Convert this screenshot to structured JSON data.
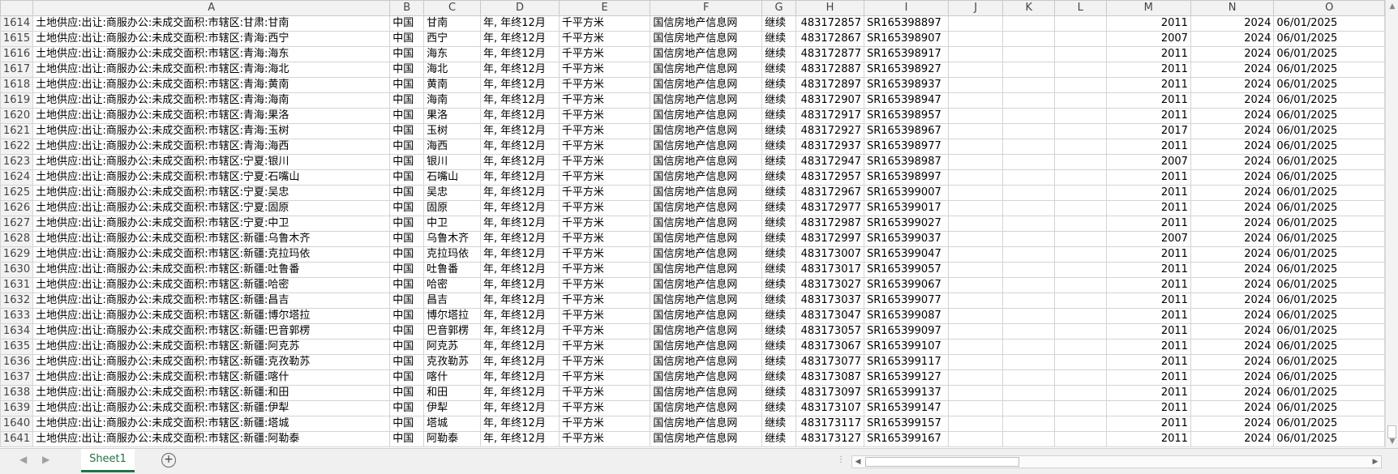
{
  "columns": [
    "A",
    "B",
    "C",
    "D",
    "E",
    "F",
    "G",
    "H",
    "I",
    "J",
    "K",
    "L",
    "M",
    "N",
    "O"
  ],
  "rows": [
    {
      "n": "1614",
      "a": "土地供应:出让:商服办公:未成交面积:市辖区:甘肃:甘南",
      "b": "中国",
      "c": "甘南",
      "d": "年, 年终12月",
      "e": "千平方米",
      "f": "国信房地产信息网",
      "g": "继续",
      "h": "483172857",
      "i": "SR165398897",
      "m": "2011",
      "nn": "2024",
      "o": "06/01/2025"
    },
    {
      "n": "1615",
      "a": "土地供应:出让:商服办公:未成交面积:市辖区:青海:西宁",
      "b": "中国",
      "c": "西宁",
      "d": "年, 年终12月",
      "e": "千平方米",
      "f": "国信房地产信息网",
      "g": "继续",
      "h": "483172867",
      "i": "SR165398907",
      "m": "2007",
      "nn": "2024",
      "o": "06/01/2025"
    },
    {
      "n": "1616",
      "a": "土地供应:出让:商服办公:未成交面积:市辖区:青海:海东",
      "b": "中国",
      "c": "海东",
      "d": "年, 年终12月",
      "e": "千平方米",
      "f": "国信房地产信息网",
      "g": "继续",
      "h": "483172877",
      "i": "SR165398917",
      "m": "2011",
      "nn": "2024",
      "o": "06/01/2025"
    },
    {
      "n": "1617",
      "a": "土地供应:出让:商服办公:未成交面积:市辖区:青海:海北",
      "b": "中国",
      "c": "海北",
      "d": "年, 年终12月",
      "e": "千平方米",
      "f": "国信房地产信息网",
      "g": "继续",
      "h": "483172887",
      "i": "SR165398927",
      "m": "2011",
      "nn": "2024",
      "o": "06/01/2025"
    },
    {
      "n": "1618",
      "a": "土地供应:出让:商服办公:未成交面积:市辖区:青海:黄南",
      "b": "中国",
      "c": "黄南",
      "d": "年, 年终12月",
      "e": "千平方米",
      "f": "国信房地产信息网",
      "g": "继续",
      "h": "483172897",
      "i": "SR165398937",
      "m": "2011",
      "nn": "2024",
      "o": "06/01/2025"
    },
    {
      "n": "1619",
      "a": "土地供应:出让:商服办公:未成交面积:市辖区:青海:海南",
      "b": "中国",
      "c": "海南",
      "d": "年, 年终12月",
      "e": "千平方米",
      "f": "国信房地产信息网",
      "g": "继续",
      "h": "483172907",
      "i": "SR165398947",
      "m": "2011",
      "nn": "2024",
      "o": "06/01/2025"
    },
    {
      "n": "1620",
      "a": "土地供应:出让:商服办公:未成交面积:市辖区:青海:果洛",
      "b": "中国",
      "c": "果洛",
      "d": "年, 年终12月",
      "e": "千平方米",
      "f": "国信房地产信息网",
      "g": "继续",
      "h": "483172917",
      "i": "SR165398957",
      "m": "2011",
      "nn": "2024",
      "o": "06/01/2025"
    },
    {
      "n": "1621",
      "a": "土地供应:出让:商服办公:未成交面积:市辖区:青海:玉树",
      "b": "中国",
      "c": "玉树",
      "d": "年, 年终12月",
      "e": "千平方米",
      "f": "国信房地产信息网",
      "g": "继续",
      "h": "483172927",
      "i": "SR165398967",
      "m": "2017",
      "nn": "2024",
      "o": "06/01/2025"
    },
    {
      "n": "1622",
      "a": "土地供应:出让:商服办公:未成交面积:市辖区:青海:海西",
      "b": "中国",
      "c": "海西",
      "d": "年, 年终12月",
      "e": "千平方米",
      "f": "国信房地产信息网",
      "g": "继续",
      "h": "483172937",
      "i": "SR165398977",
      "m": "2011",
      "nn": "2024",
      "o": "06/01/2025"
    },
    {
      "n": "1623",
      "a": "土地供应:出让:商服办公:未成交面积:市辖区:宁夏:银川",
      "b": "中国",
      "c": "银川",
      "d": "年, 年终12月",
      "e": "千平方米",
      "f": "国信房地产信息网",
      "g": "继续",
      "h": "483172947",
      "i": "SR165398987",
      "m": "2007",
      "nn": "2024",
      "o": "06/01/2025"
    },
    {
      "n": "1624",
      "a": "土地供应:出让:商服办公:未成交面积:市辖区:宁夏:石嘴山",
      "b": "中国",
      "c": "石嘴山",
      "d": "年, 年终12月",
      "e": "千平方米",
      "f": "国信房地产信息网",
      "g": "继续",
      "h": "483172957",
      "i": "SR165398997",
      "m": "2011",
      "nn": "2024",
      "o": "06/01/2025"
    },
    {
      "n": "1625",
      "a": "土地供应:出让:商服办公:未成交面积:市辖区:宁夏:吴忠",
      "b": "中国",
      "c": "吴忠",
      "d": "年, 年终12月",
      "e": "千平方米",
      "f": "国信房地产信息网",
      "g": "继续",
      "h": "483172967",
      "i": "SR165399007",
      "m": "2011",
      "nn": "2024",
      "o": "06/01/2025"
    },
    {
      "n": "1626",
      "a": "土地供应:出让:商服办公:未成交面积:市辖区:宁夏:固原",
      "b": "中国",
      "c": "固原",
      "d": "年, 年终12月",
      "e": "千平方米",
      "f": "国信房地产信息网",
      "g": "继续",
      "h": "483172977",
      "i": "SR165399017",
      "m": "2011",
      "nn": "2024",
      "o": "06/01/2025"
    },
    {
      "n": "1627",
      "a": "土地供应:出让:商服办公:未成交面积:市辖区:宁夏:中卫",
      "b": "中国",
      "c": "中卫",
      "d": "年, 年终12月",
      "e": "千平方米",
      "f": "国信房地产信息网",
      "g": "继续",
      "h": "483172987",
      "i": "SR165399027",
      "m": "2011",
      "nn": "2024",
      "o": "06/01/2025"
    },
    {
      "n": "1628",
      "a": "土地供应:出让:商服办公:未成交面积:市辖区:新疆:乌鲁木齐",
      "b": "中国",
      "c": "乌鲁木齐",
      "d": "年, 年终12月",
      "e": "千平方米",
      "f": "国信房地产信息网",
      "g": "继续",
      "h": "483172997",
      "i": "SR165399037",
      "m": "2007",
      "nn": "2024",
      "o": "06/01/2025"
    },
    {
      "n": "1629",
      "a": "土地供应:出让:商服办公:未成交面积:市辖区:新疆:克拉玛依",
      "b": "中国",
      "c": "克拉玛依",
      "d": "年, 年终12月",
      "e": "千平方米",
      "f": "国信房地产信息网",
      "g": "继续",
      "h": "483173007",
      "i": "SR165399047",
      "m": "2011",
      "nn": "2024",
      "o": "06/01/2025"
    },
    {
      "n": "1630",
      "a": "土地供应:出让:商服办公:未成交面积:市辖区:新疆:吐鲁番",
      "b": "中国",
      "c": "吐鲁番",
      "d": "年, 年终12月",
      "e": "千平方米",
      "f": "国信房地产信息网",
      "g": "继续",
      "h": "483173017",
      "i": "SR165399057",
      "m": "2011",
      "nn": "2024",
      "o": "06/01/2025"
    },
    {
      "n": "1631",
      "a": "土地供应:出让:商服办公:未成交面积:市辖区:新疆:哈密",
      "b": "中国",
      "c": "哈密",
      "d": "年, 年终12月",
      "e": "千平方米",
      "f": "国信房地产信息网",
      "g": "继续",
      "h": "483173027",
      "i": "SR165399067",
      "m": "2011",
      "nn": "2024",
      "o": "06/01/2025"
    },
    {
      "n": "1632",
      "a": "土地供应:出让:商服办公:未成交面积:市辖区:新疆:昌吉",
      "b": "中国",
      "c": "昌吉",
      "d": "年, 年终12月",
      "e": "千平方米",
      "f": "国信房地产信息网",
      "g": "继续",
      "h": "483173037",
      "i": "SR165399077",
      "m": "2011",
      "nn": "2024",
      "o": "06/01/2025"
    },
    {
      "n": "1633",
      "a": "土地供应:出让:商服办公:未成交面积:市辖区:新疆:博尔塔拉",
      "b": "中国",
      "c": "博尔塔拉",
      "d": "年, 年终12月",
      "e": "千平方米",
      "f": "国信房地产信息网",
      "g": "继续",
      "h": "483173047",
      "i": "SR165399087",
      "m": "2011",
      "nn": "2024",
      "o": "06/01/2025"
    },
    {
      "n": "1634",
      "a": "土地供应:出让:商服办公:未成交面积:市辖区:新疆:巴音郭楞",
      "b": "中国",
      "c": "巴音郭楞",
      "d": "年, 年终12月",
      "e": "千平方米",
      "f": "国信房地产信息网",
      "g": "继续",
      "h": "483173057",
      "i": "SR165399097",
      "m": "2011",
      "nn": "2024",
      "o": "06/01/2025"
    },
    {
      "n": "1635",
      "a": "土地供应:出让:商服办公:未成交面积:市辖区:新疆:阿克苏",
      "b": "中国",
      "c": "阿克苏",
      "d": "年, 年终12月",
      "e": "千平方米",
      "f": "国信房地产信息网",
      "g": "继续",
      "h": "483173067",
      "i": "SR165399107",
      "m": "2011",
      "nn": "2024",
      "o": "06/01/2025"
    },
    {
      "n": "1636",
      "a": "土地供应:出让:商服办公:未成交面积:市辖区:新疆:克孜勒苏",
      "b": "中国",
      "c": "克孜勒苏",
      "d": "年, 年终12月",
      "e": "千平方米",
      "f": "国信房地产信息网",
      "g": "继续",
      "h": "483173077",
      "i": "SR165399117",
      "m": "2011",
      "nn": "2024",
      "o": "06/01/2025"
    },
    {
      "n": "1637",
      "a": "土地供应:出让:商服办公:未成交面积:市辖区:新疆:喀什",
      "b": "中国",
      "c": "喀什",
      "d": "年, 年终12月",
      "e": "千平方米",
      "f": "国信房地产信息网",
      "g": "继续",
      "h": "483173087",
      "i": "SR165399127",
      "m": "2011",
      "nn": "2024",
      "o": "06/01/2025"
    },
    {
      "n": "1638",
      "a": "土地供应:出让:商服办公:未成交面积:市辖区:新疆:和田",
      "b": "中国",
      "c": "和田",
      "d": "年, 年终12月",
      "e": "千平方米",
      "f": "国信房地产信息网",
      "g": "继续",
      "h": "483173097",
      "i": "SR165399137",
      "m": "2011",
      "nn": "2024",
      "o": "06/01/2025"
    },
    {
      "n": "1639",
      "a": "土地供应:出让:商服办公:未成交面积:市辖区:新疆:伊犁",
      "b": "中国",
      "c": "伊犁",
      "d": "年, 年终12月",
      "e": "千平方米",
      "f": "国信房地产信息网",
      "g": "继续",
      "h": "483173107",
      "i": "SR165399147",
      "m": "2011",
      "nn": "2024",
      "o": "06/01/2025"
    },
    {
      "n": "1640",
      "a": "土地供应:出让:商服办公:未成交面积:市辖区:新疆:塔城",
      "b": "中国",
      "c": "塔城",
      "d": "年, 年终12月",
      "e": "千平方米",
      "f": "国信房地产信息网",
      "g": "继续",
      "h": "483173117",
      "i": "SR165399157",
      "m": "2011",
      "nn": "2024",
      "o": "06/01/2025"
    },
    {
      "n": "1641",
      "a": "土地供应:出让:商服办公:未成交面积:市辖区:新疆:阿勒泰",
      "b": "中国",
      "c": "阿勒泰",
      "d": "年, 年终12月",
      "e": "千平方米",
      "f": "国信房地产信息网",
      "g": "继续",
      "h": "483173127",
      "i": "SR165399167",
      "m": "2011",
      "nn": "2024",
      "o": "06/01/2025"
    }
  ],
  "tabbar": {
    "sheet_tab": "Sheet1",
    "add_sheet_icon": "plus-circle-icon",
    "nav_left_icon": "triangle-left-icon",
    "nav_right_icon": "triangle-right-icon"
  },
  "colors": {
    "accent": "#217346",
    "header_bg": "#f2f2f2",
    "gridline": "#d4d4d4"
  }
}
